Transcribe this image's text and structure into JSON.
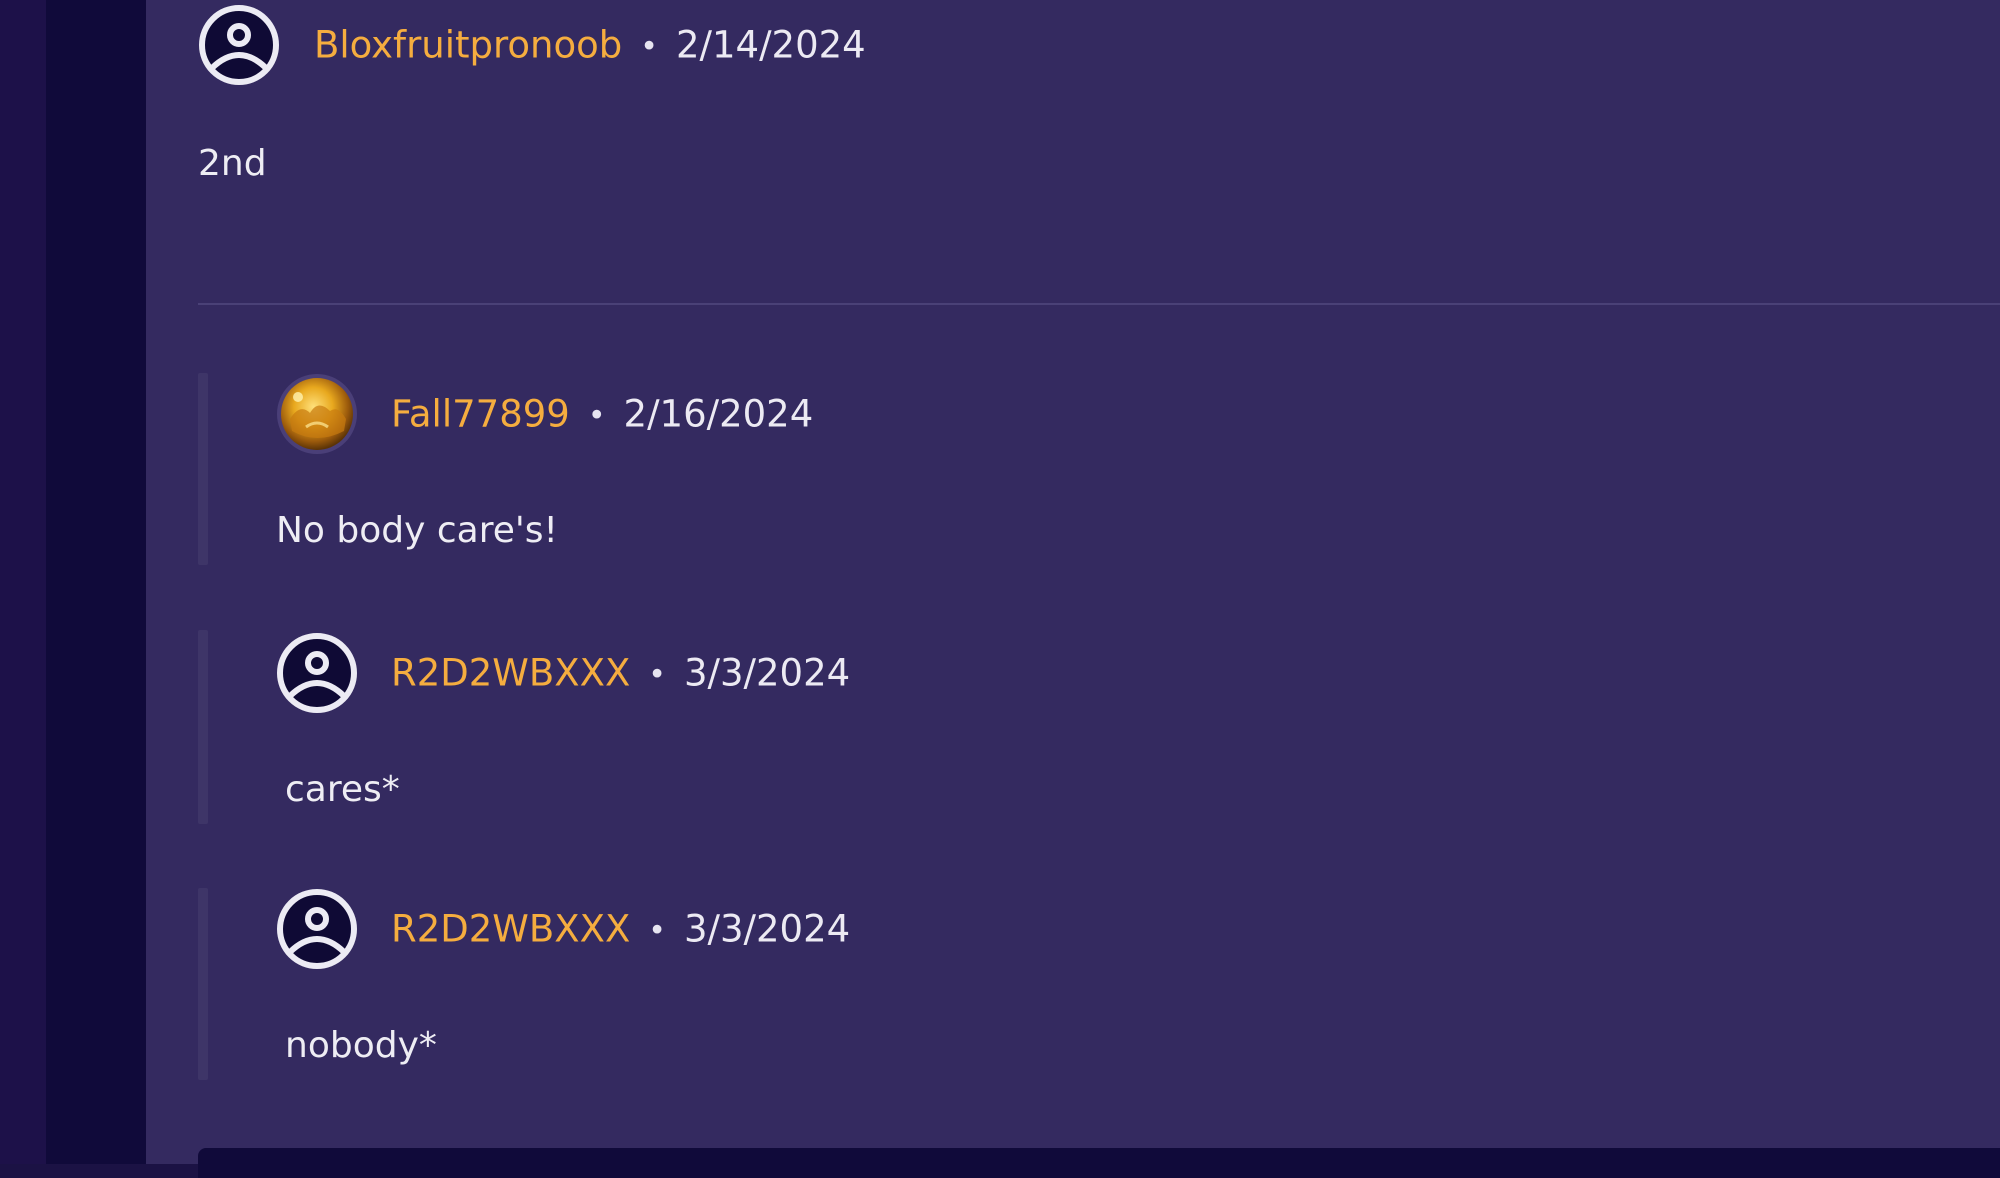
{
  "comments": [
    {
      "username": "Bloxfruitpronoob",
      "separator": "•",
      "date": "2/14/2024",
      "body": "2nd",
      "avatar_icon": "default-user-icon"
    }
  ],
  "replies": [
    {
      "username": "Fall77899",
      "separator": "•",
      "date": "2/16/2024",
      "body": "No body care's!",
      "avatar_icon": "gold-photo-avatar"
    },
    {
      "username": "R2D2WBXXX",
      "separator": "•",
      "date": "3/3/2024",
      "body": "cares*",
      "avatar_icon": "default-user-icon"
    },
    {
      "username": "R2D2WBXXX",
      "separator": "•",
      "date": "3/3/2024",
      "body": "nobody*",
      "avatar_icon": "default-user-icon"
    }
  ],
  "colors": {
    "username": "#f5ad3f",
    "panel_background": "#342a60",
    "rail_background": "#100a3a",
    "text": "#eeedf4"
  }
}
